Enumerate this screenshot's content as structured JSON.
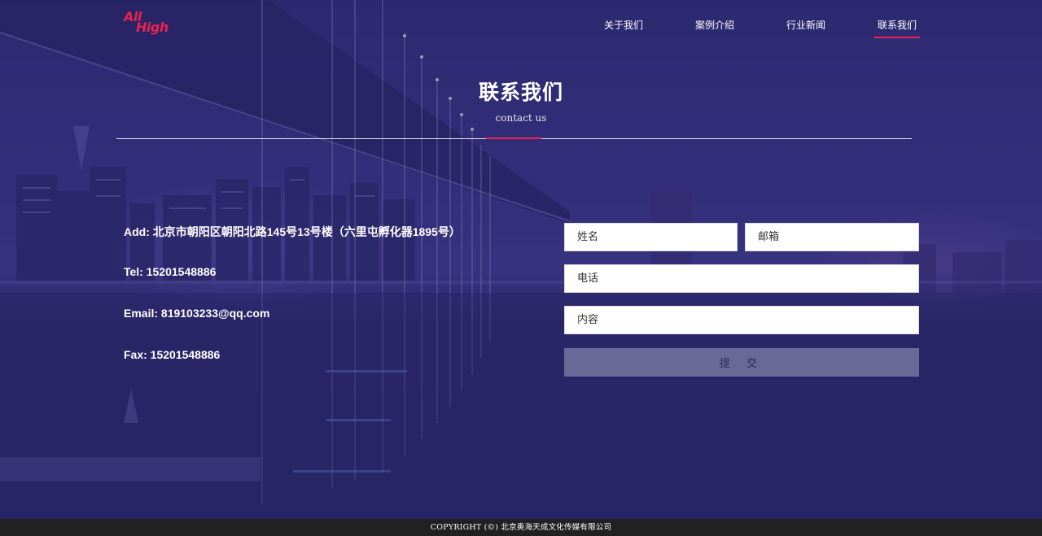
{
  "brand": {
    "logo_line1": "All",
    "logo_line2": "High",
    "accent": "#e8234f"
  },
  "nav": {
    "items": [
      {
        "label": "关于我们"
      },
      {
        "label": "案例介绍"
      },
      {
        "label": "行业新闻"
      },
      {
        "label": "联系我们",
        "active": true
      }
    ]
  },
  "section": {
    "title": "联系我们",
    "subtitle": "contact us"
  },
  "contact": {
    "address": "Add: 北京市朝阳区朝阳北路145号13号楼（六里屯孵化器1895号）",
    "tel": "Tel: 15201548886",
    "email": "Email: 819103233@qq.com",
    "fax": "Fax: 15201548886"
  },
  "form": {
    "name_placeholder": "姓名",
    "email_placeholder": "邮箱",
    "phone_placeholder": "电话",
    "content_placeholder": "内容",
    "submit_label": "提 交"
  },
  "footer": {
    "copyright": "COPYRIGHT (©) 北京奥海天成文化传媒有限公司"
  }
}
